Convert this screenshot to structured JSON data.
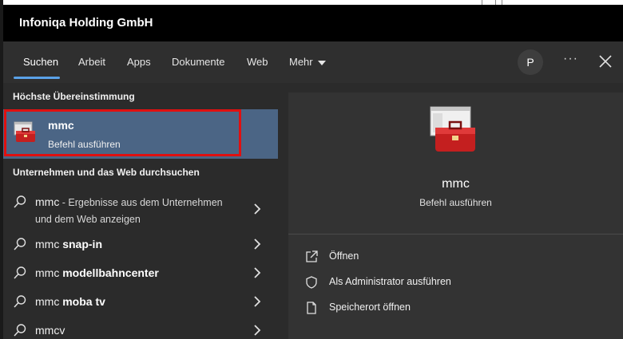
{
  "header": {
    "title": "Infoniqa Holding GmbH"
  },
  "tabs": [
    {
      "label": "Suchen"
    },
    {
      "label": "Arbeit"
    },
    {
      "label": "Apps"
    },
    {
      "label": "Dokumente"
    },
    {
      "label": "Web"
    },
    {
      "label": "Mehr"
    }
  ],
  "account": {
    "initial": "P"
  },
  "more_label": "···",
  "left": {
    "best_match_heading": "Höchste Übereinstimmung",
    "best_match": {
      "name": "mmc",
      "subtitle": "Befehl ausführen"
    },
    "web_heading": "Unternehmen und das Web durchsuchen",
    "results": [
      {
        "prefix": "mmc",
        "bold": "",
        "note": " - Ergebnisse aus dem Unternehmen",
        "note2": "und dem Web anzeigen"
      },
      {
        "prefix": "mmc ",
        "bold": "snap-in"
      },
      {
        "prefix": "mmc ",
        "bold": "modellbahncenter"
      },
      {
        "prefix": "mmc ",
        "bold": "moba tv"
      },
      {
        "prefix": "mmcv",
        "bold": ""
      }
    ]
  },
  "preview": {
    "name": "mmc",
    "subtitle": "Befehl ausführen",
    "actions": [
      {
        "label": "Öffnen",
        "icon": "open-icon"
      },
      {
        "label": "Als Administrator ausführen",
        "icon": "shield-icon"
      },
      {
        "label": "Speicherort öffnen",
        "icon": "file-location-icon"
      }
    ]
  },
  "colors": {
    "accent": "#5aa2e8",
    "highlight": "#4b6585",
    "annotation": "#e01010"
  }
}
